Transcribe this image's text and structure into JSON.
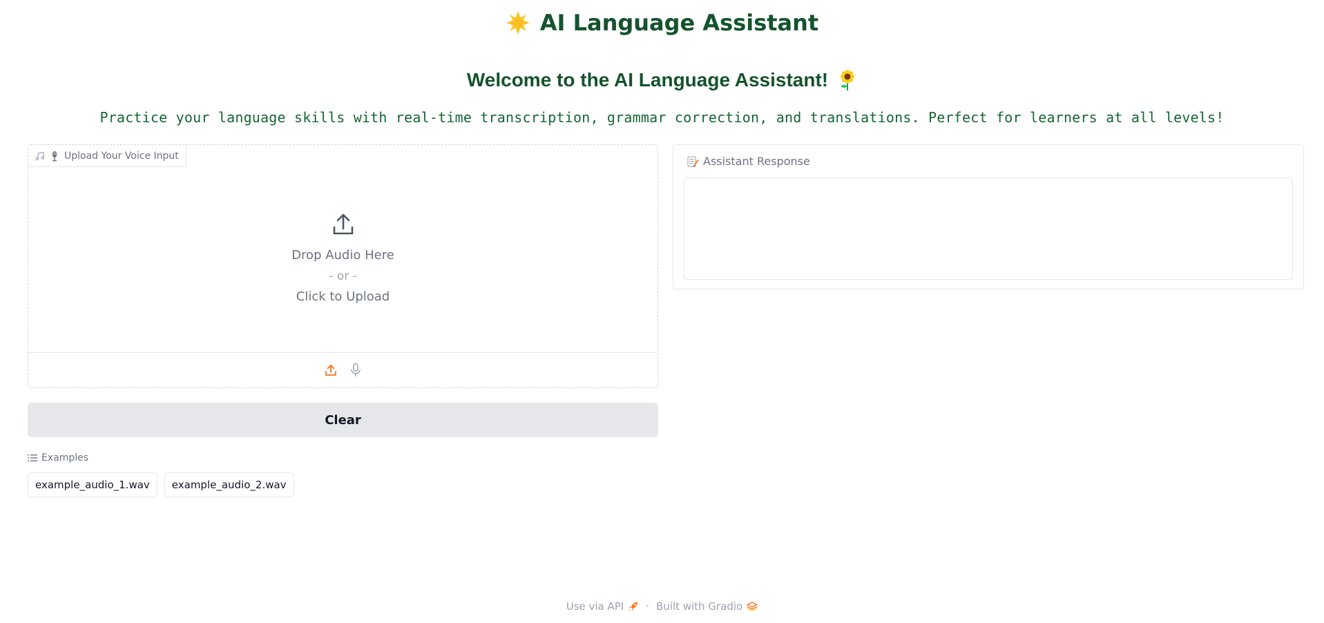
{
  "header": {
    "title": "AI Language Assistant",
    "welcome": "Welcome to the AI Language Assistant!",
    "subtitle": "Practice your language skills with real-time transcription, grammar correction, and translations. Perfect for learners at all levels!"
  },
  "upload": {
    "label": "Upload Your Voice Input",
    "drop_text": "Drop Audio Here",
    "or_text": "- or -",
    "click_text": "Click to Upload"
  },
  "clear_button": {
    "label": "Clear"
  },
  "examples": {
    "label": "Examples",
    "items": [
      "example_audio_1.wav",
      "example_audio_2.wav"
    ]
  },
  "response": {
    "label": "Assistant Response",
    "value": ""
  },
  "footer": {
    "api_link": "Use via API",
    "separator": "·",
    "built_with": "Built with Gradio"
  },
  "colors": {
    "title_green": "#14532d",
    "subtitle_green": "#166534",
    "accent_orange": "#f97316",
    "button_gray": "#e5e7eb"
  },
  "icons": [
    "sun-icon",
    "sunflower-icon",
    "music-note-icon",
    "microphone-icon",
    "upload-icon",
    "list-icon",
    "memo-icon",
    "rocket-icon",
    "gradio-logo-icon"
  ]
}
